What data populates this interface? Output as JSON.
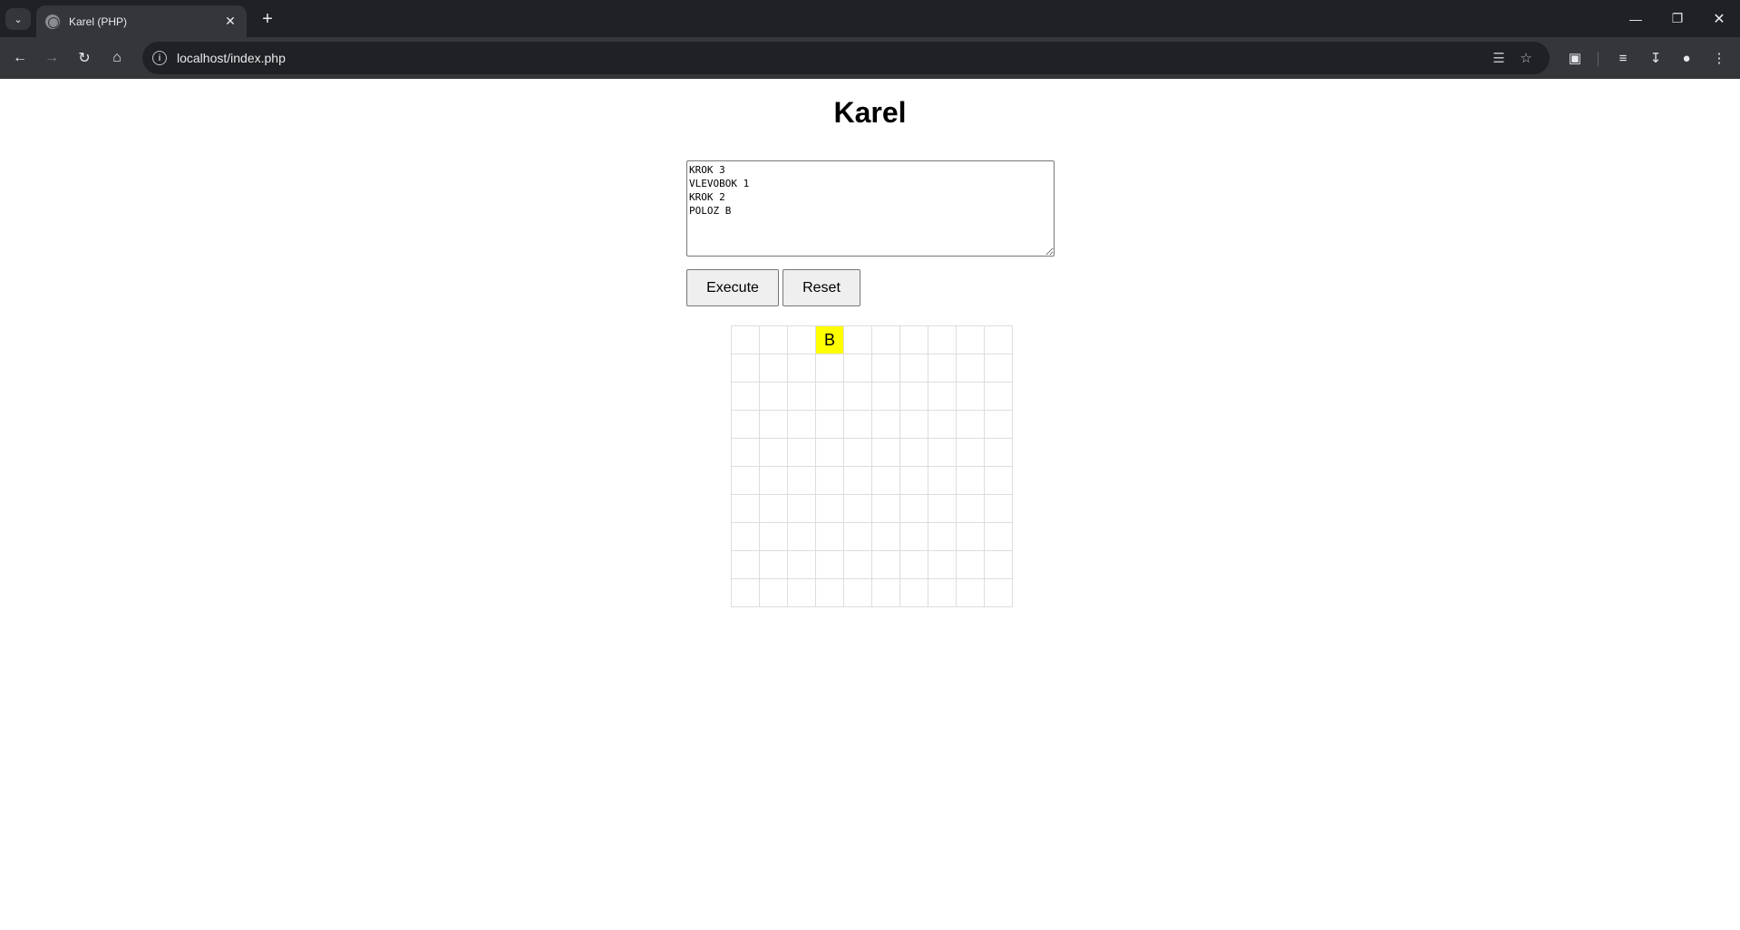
{
  "browser": {
    "tab_title": "Karel (PHP)",
    "url": "localhost/index.php"
  },
  "page": {
    "title": "Karel",
    "program_text": "KROK 3\nVLEVOBOK 1\nKROK 2\nPOLOZ B",
    "execute_label": "Execute",
    "reset_label": "Reset"
  },
  "grid": {
    "rows": 10,
    "cols": 10,
    "cells": [
      {
        "row": 0,
        "col": 3,
        "text": "B",
        "color": "#ffff00"
      }
    ]
  },
  "colors": {
    "marked_cell": "#ffff00",
    "grid_line": "#dddddd"
  }
}
